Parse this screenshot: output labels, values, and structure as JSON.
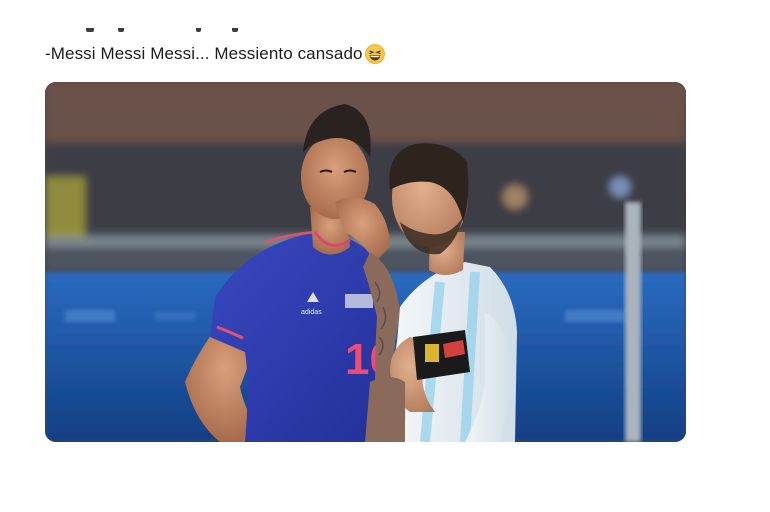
{
  "tweet": {
    "text": "-Messi Messi Messi... Messiento cansado",
    "emoji": "grinning-squinting-face"
  },
  "media": {
    "kind": "photo",
    "jersey_number": "10"
  },
  "colors": {
    "text": "#1c1c1c",
    "background": "#ffffff",
    "colombia_jersey": "#2f3fa8",
    "argentina_jersey": "#e9f0f4",
    "pitch_board": "#1e5aa8"
  }
}
